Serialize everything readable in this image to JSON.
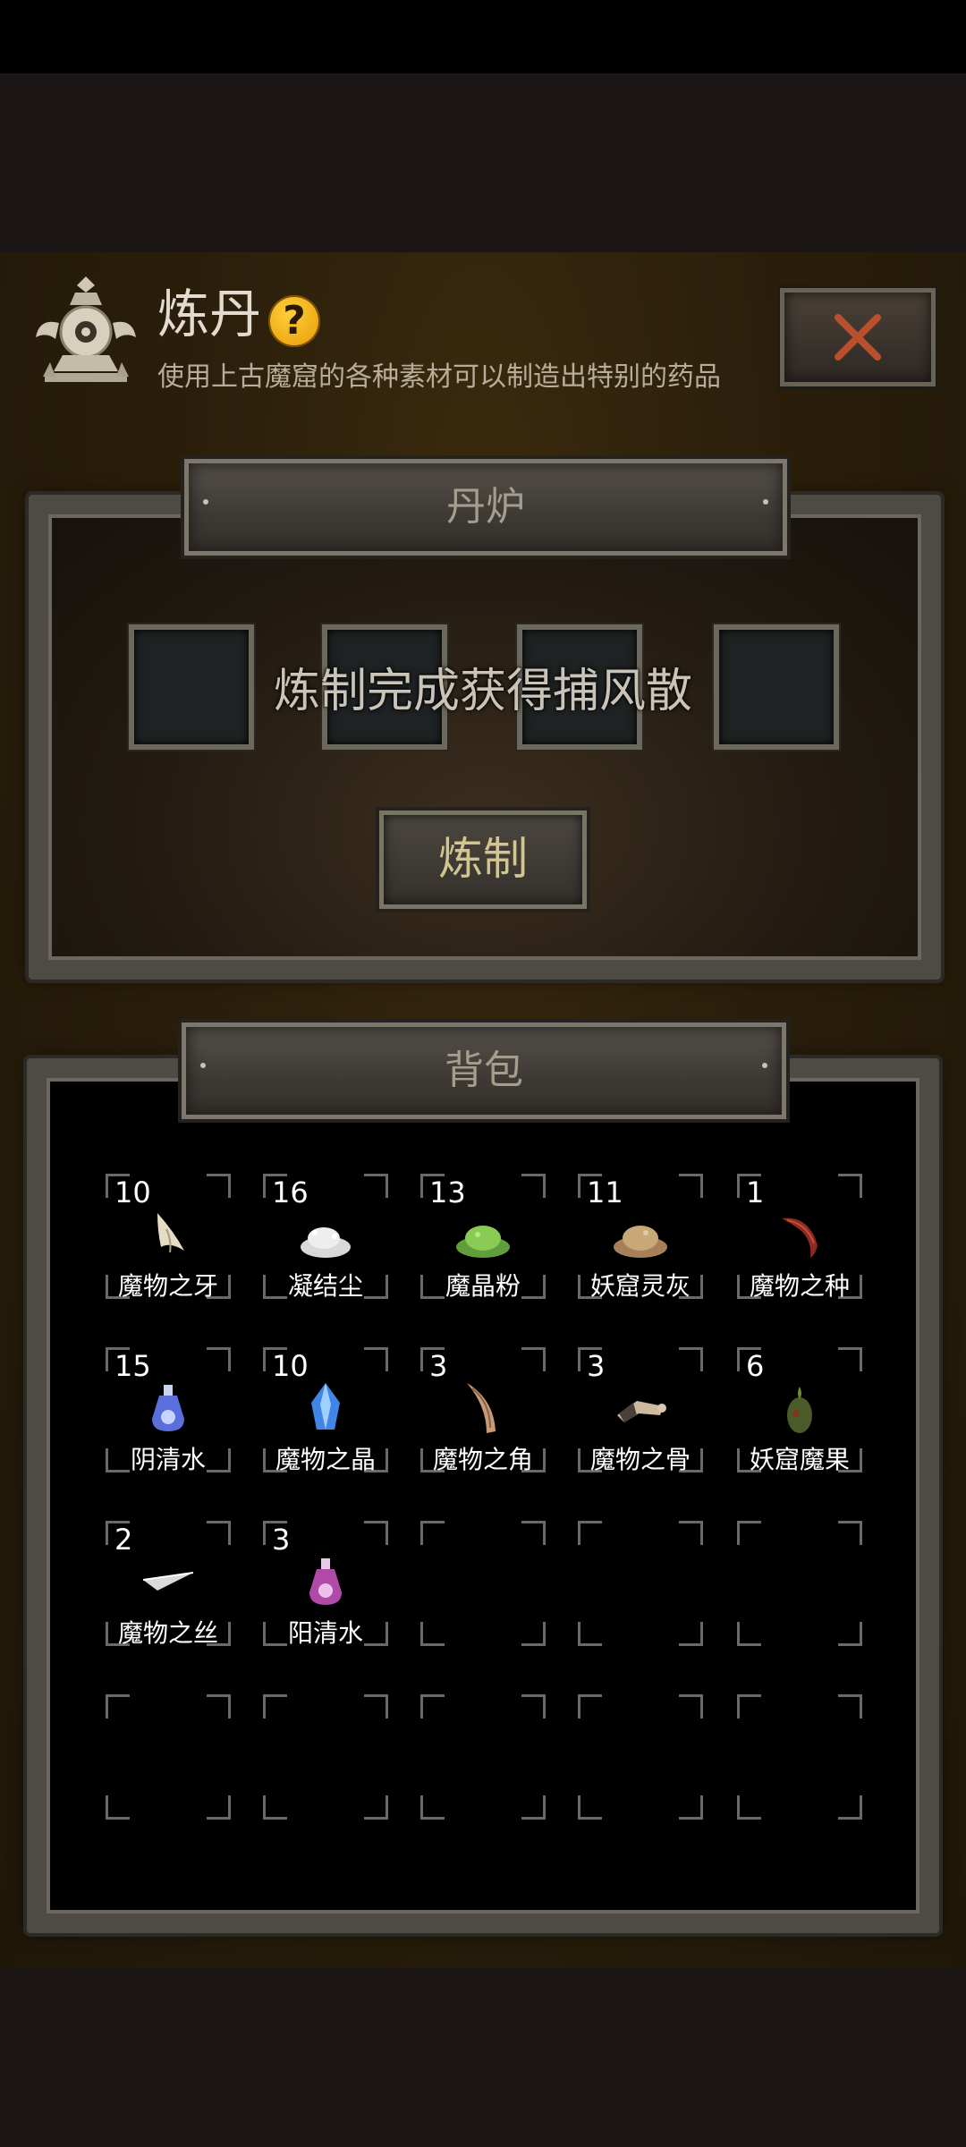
{
  "header": {
    "title": "炼丹",
    "help_glyph": "?",
    "subtitle": "使用上古魔窟的各种素材可以制造出特别的药品",
    "close_label": "×"
  },
  "furnace": {
    "title": "丹炉",
    "message": "炼制完成获得捕风散",
    "craft_label": "炼制",
    "slots": 4
  },
  "bag": {
    "title": "背包",
    "items": [
      {
        "count": "10",
        "name": "魔物之牙",
        "icon": "fang-icon"
      },
      {
        "count": "16",
        "name": "凝结尘",
        "icon": "dust-pile-icon"
      },
      {
        "count": "13",
        "name": "魔晶粉",
        "icon": "green-powder-icon"
      },
      {
        "count": "11",
        "name": "妖窟灵灰",
        "icon": "ash-pile-icon"
      },
      {
        "count": "1",
        "name": "魔物之种",
        "icon": "seed-icon"
      },
      {
        "count": "15",
        "name": "阴清水",
        "icon": "blue-potion-icon"
      },
      {
        "count": "10",
        "name": "魔物之晶",
        "icon": "blue-crystal-icon"
      },
      {
        "count": "3",
        "name": "魔物之角",
        "icon": "horn-icon"
      },
      {
        "count": "3",
        "name": "魔物之骨",
        "icon": "bone-icon"
      },
      {
        "count": "6",
        "name": "妖窟魔果",
        "icon": "fruit-icon"
      },
      {
        "count": "2",
        "name": "魔物之丝",
        "icon": "silk-icon"
      },
      {
        "count": "3",
        "name": "阳清水",
        "icon": "purple-potion-icon"
      }
    ],
    "total_slots": 20
  },
  "colors": {
    "accent_gold": "#d2c58f",
    "close_red": "#b8502e",
    "help_orange": "#f0a818"
  }
}
